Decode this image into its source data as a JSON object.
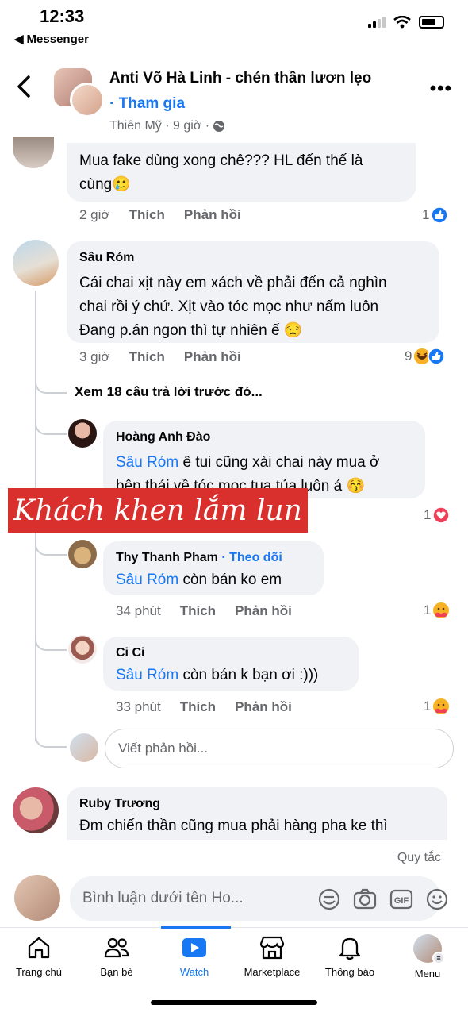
{
  "status_bar": {
    "time": "12:33",
    "back_app": "Messenger"
  },
  "header": {
    "title": "Anti Võ Hà Linh - chén thần lươn lẹo",
    "join": "· Tham gia",
    "sub": "Thiên Mỹ · 9 giờ ·"
  },
  "comments": [
    {
      "text": "Mua fake dùng xong chê??? HL đến thế là",
      "text2": "cùng",
      "emoji": "🥲",
      "time": "2 giờ",
      "like": "Thích",
      "reply": "Phản hồi",
      "reactions": "1"
    },
    {
      "author": "Sâu Róm",
      "lines": [
        "Cái chai xịt này em xách về phải đến cả nghìn",
        "chai rồi ý chứ. Xịt vào tóc mọc như nấm luôn",
        "Đang p.án ngon thì tự nhiên ế"
      ],
      "emoji": "😒",
      "time": "3 giờ",
      "like": "Thích",
      "reply": "Phản hồi",
      "reactions": "9"
    }
  ],
  "view_more": "Xem 18 câu trả lời trước đó...",
  "replies": [
    {
      "author": "Hoàng Anh Đào",
      "mention": "Sâu Róm",
      "text": " ê tui cũng xài chai này mua ở",
      "text2": "bên thái về tóc mọc tua tủa luôn á",
      "emoji": "😚",
      "reactions": "1"
    },
    {
      "author": "Thy Thanh Pham",
      "follow": "· Theo dõi",
      "mention": "Sâu Róm",
      "text": " còn bán ko em",
      "time": "34 phút",
      "like": "Thích",
      "reply": "Phản hồi",
      "reactions": "1"
    },
    {
      "author": "Ci Ci",
      "mention": "Sâu Róm",
      "text": " còn bán k bạn ơi :)))",
      "time": "33 phút",
      "like": "Thích",
      "reply": "Phản hồi",
      "reactions": "1"
    }
  ],
  "overlay_text": "Khách khen lắm lun",
  "reply_placeholder": "Viết phản hồi...",
  "last_comment": {
    "author": "Ruby Trương",
    "text": "Đm chiến thần cũng mua phải hàng pha ke thì"
  },
  "rules": "Quy tắc",
  "comment_placeholder": "Bình luận dưới tên Ho...",
  "tabs": [
    {
      "label": "Trang chủ",
      "icon": "home-icon"
    },
    {
      "label": "Bạn bè",
      "icon": "friends-icon"
    },
    {
      "label": "Watch",
      "icon": "watch-icon"
    },
    {
      "label": "Marketplace",
      "icon": "marketplace-icon"
    },
    {
      "label": "Thông báo",
      "icon": "bell-icon"
    },
    {
      "label": "Menu",
      "icon": "menu-avatar-icon"
    }
  ],
  "colors": {
    "accent": "#1877f2",
    "bubble": "#f0f2f5",
    "overlay": "#d9302e"
  }
}
